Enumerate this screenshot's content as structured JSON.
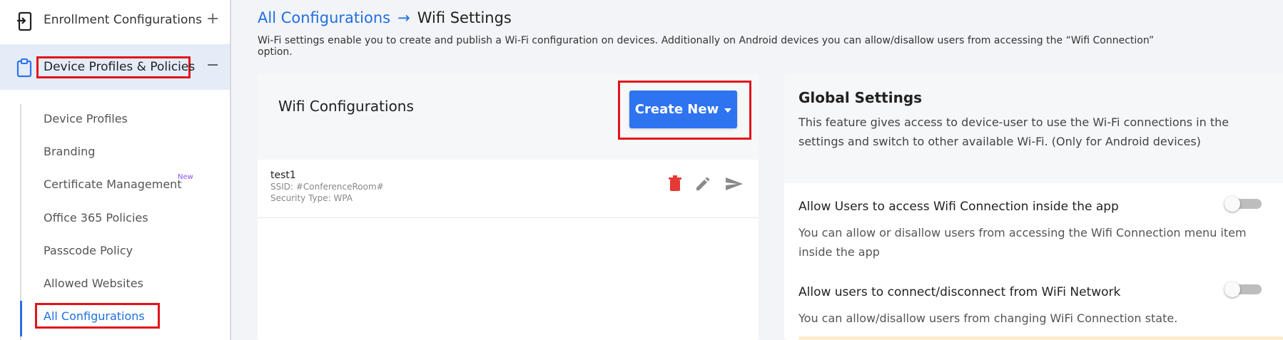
{
  "sidebar": {
    "enrollment_label": "Enrollment Configurations",
    "enrollment_toggle": "+",
    "device_profiles_label": "Device Profiles & Policies",
    "device_profiles_toggle": "−",
    "sub_items": [
      {
        "label": "Device Profiles"
      },
      {
        "label": "Branding"
      },
      {
        "label": "Certificate Management",
        "badge": "New"
      },
      {
        "label": "Office 365 Policies"
      },
      {
        "label": "Passcode Policy"
      },
      {
        "label": "Allowed Websites"
      },
      {
        "label": "All Configurations"
      }
    ],
    "icons": [
      "phone-enroll-icon",
      "clipboard-icon"
    ]
  },
  "breadcrumb": {
    "parent": "All Configurations",
    "current": "Wifi Settings"
  },
  "description": "Wi-Fi settings enable you to create and publish a Wi-Fi configuration on devices. Additionally on Android devices you can allow/disallow users from accessing the “Wifi Connection” option.",
  "wifi_card": {
    "title": "Wifi Configurations",
    "create_label": "Create New",
    "items": [
      {
        "name": "test1",
        "ssid": "SSID: #ConferenceRoom#",
        "security": "Security Type: WPA"
      }
    ]
  },
  "global_settings": {
    "title": "Global Settings",
    "description": "This feature gives access to device-user to use the Wi-Fi connections in the settings and switch to other available Wi-Fi. (Only for Android devices)",
    "settings": [
      {
        "title": "Allow Users to access Wifi Connection inside the app",
        "description": "You can allow or disallow users from accessing the Wifi Connection menu item inside the app",
        "enabled": false
      },
      {
        "title": "Allow users to connect/disconnect from WiFi Network",
        "description": "You can allow/disallow users from changing WiFi Connection state.",
        "enabled": false
      }
    ]
  },
  "colors": {
    "accent": "#2e73f0",
    "link": "#1f6fe0",
    "highlight_box": "#e2131c",
    "delete": "#e53935",
    "badge": "#8a4fff"
  }
}
